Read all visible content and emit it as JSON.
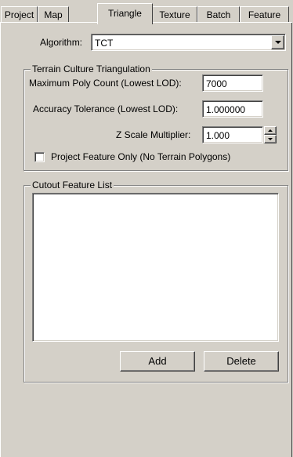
{
  "tabs": [
    {
      "label": "Project",
      "active": false
    },
    {
      "label": "Map",
      "active": false
    },
    {
      "label": "Triangle",
      "active": true
    },
    {
      "label": "Texture",
      "active": false
    },
    {
      "label": "Batch",
      "active": false
    },
    {
      "label": "Feature",
      "active": false
    }
  ],
  "algorithm": {
    "label": "Algorithm:",
    "value": "TCT"
  },
  "terrain_group": {
    "title": "Terrain Culture Triangulation",
    "max_poly_label": "Maximum Poly Count (Lowest LOD):",
    "max_poly_value": "7000",
    "accuracy_label": "Accuracy Tolerance (Lowest LOD):",
    "accuracy_value": "1.000000",
    "zscale_label": "Z Scale Multiplier:",
    "zscale_value": "1.000",
    "project_feature_label": "Project Feature Only (No Terrain Polygons)",
    "project_feature_checked": false
  },
  "cutout_group": {
    "title": "Cutout Feature List",
    "items": [],
    "add_label": "Add",
    "delete_label": "Delete"
  },
  "icons": {
    "dropdown": "chevron-down-icon",
    "spin_up": "spin-up-icon",
    "spin_down": "spin-down-icon"
  }
}
